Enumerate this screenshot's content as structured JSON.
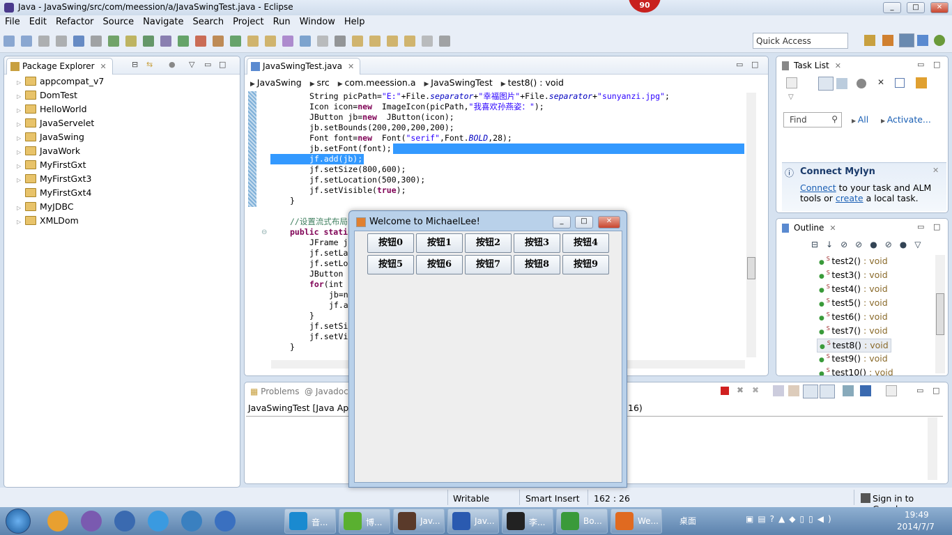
{
  "window": {
    "title": "Java - JavaSwing/src/com/meession/a/JavaSwingTest.java - Eclipse",
    "badge": "90",
    "min": "_",
    "max": "□",
    "close": "✕"
  },
  "menu": [
    "File",
    "Edit",
    "Refactor",
    "Source",
    "Navigate",
    "Search",
    "Project",
    "Run",
    "Window",
    "Help"
  ],
  "toolbar": {
    "icon_colors": [
      "#6b8fc4",
      "#6b8fc4",
      "#999",
      "#999",
      "#3c6ab3",
      "#888",
      "#4a8a3a",
      "#b0a030",
      "#3a7a3a",
      "#6a5a9a",
      "#3a8a3a",
      "#c04020",
      "#b06a20",
      "#3c8a3c",
      "#c8a040",
      "#c8a040",
      "#9a6ac0",
      "#5a8ac0",
      "#aaa",
      "#777",
      "#c8a040",
      "#c8a040",
      "#c8a040",
      "#c8a040",
      "#aaa",
      "#888"
    ],
    "quick_access": "Quick Access"
  },
  "package_explorer": {
    "title": "Package Explorer",
    "items": [
      {
        "label": "appcompat_v7",
        "expandable": true
      },
      {
        "label": "DomTest",
        "expandable": true
      },
      {
        "label": "HelloWorld",
        "expandable": true
      },
      {
        "label": "JavaServelet",
        "expandable": true
      },
      {
        "label": "JavaSwing",
        "expandable": true
      },
      {
        "label": "JavaWork",
        "expandable": true
      },
      {
        "label": "MyFirstGxt",
        "expandable": true
      },
      {
        "label": "MyFirstGxt3",
        "expandable": true
      },
      {
        "label": "MyFirstGxt4",
        "expandable": false
      },
      {
        "label": "MyJDBC",
        "expandable": true
      },
      {
        "label": "XMLDom",
        "expandable": true
      }
    ]
  },
  "editor": {
    "tab": "JavaSwingTest.java",
    "breadcrumb": [
      "JavaSwing",
      "src",
      "com.meession.a",
      "JavaSwingTest",
      "test8() : void"
    ],
    "lines": [
      {
        "indent": 4,
        "segs": [
          [
            "",
            "String picPath="
          ],
          [
            "str",
            "\"E:\""
          ],
          [
            "",
            "+File."
          ],
          [
            "it",
            "separator"
          ],
          [
            "",
            "+"
          ],
          [
            "str",
            "\"幸福图片\""
          ],
          [
            "",
            "+File."
          ],
          [
            "it",
            "separator"
          ],
          [
            "",
            "+"
          ],
          [
            "str",
            "\"sunyanzi.jpg\""
          ],
          [
            "",
            ";"
          ]
        ]
      },
      {
        "indent": 4,
        "segs": [
          [
            "",
            "Icon icon="
          ],
          [
            "kw",
            "new"
          ],
          [
            "",
            "  ImageIcon(picPath,"
          ],
          [
            "str",
            "\"我喜欢孙燕姿：\""
          ],
          [
            "",
            ");"
          ]
        ]
      },
      {
        "indent": 4,
        "segs": [
          [
            "",
            "JButton jb="
          ],
          [
            "kw",
            "new"
          ],
          [
            "",
            "  JButton(icon);"
          ]
        ]
      },
      {
        "indent": 4,
        "segs": [
          [
            "",
            "jb.setBounds(200,200,200,200);"
          ]
        ]
      },
      {
        "indent": 4,
        "segs": [
          [
            "",
            "Font font="
          ],
          [
            "kw",
            "new"
          ],
          [
            "",
            "  Font("
          ],
          [
            "str",
            "\"serif\""
          ],
          [
            "",
            ",Font."
          ],
          [
            "it",
            "BOLD"
          ],
          [
            "",
            ",28);"
          ]
        ]
      },
      {
        "indent": 4,
        "segs": [
          [
            "",
            "jb.setFont(font);"
          ]
        ],
        "sel": "after"
      },
      {
        "indent": 4,
        "segs": [
          [
            "",
            "jf.add(jb);"
          ]
        ],
        "sel": "full"
      },
      {
        "indent": 4,
        "segs": [
          [
            "",
            "jf.setSize(800,600);"
          ]
        ]
      },
      {
        "indent": 4,
        "segs": [
          [
            "",
            "jf.setLocation(500,300);"
          ]
        ]
      },
      {
        "indent": 4,
        "segs": [
          [
            "",
            "jf.setVisible("
          ],
          [
            "kw",
            "true"
          ],
          [
            "",
            ");"
          ]
        ]
      },
      {
        "indent": 2,
        "segs": [
          [
            "",
            "}"
          ]
        ]
      },
      {
        "indent": 0,
        "segs": []
      },
      {
        "indent": 2,
        "segs": [
          [
            "cm",
            "//设置流式布局管理"
          ]
        ]
      },
      {
        "indent": 2,
        "segs": [
          [
            "kw",
            "public static"
          ]
        ]
      },
      {
        "indent": 4,
        "segs": [
          [
            "",
            "JFrame j"
          ]
        ]
      },
      {
        "indent": 4,
        "segs": [
          [
            "",
            "jf.setLa"
          ]
        ]
      },
      {
        "indent": 4,
        "segs": [
          [
            "",
            "jf.setLo"
          ]
        ]
      },
      {
        "indent": 4,
        "segs": [
          [
            "",
            "JButton "
          ]
        ]
      },
      {
        "indent": 4,
        "segs": [
          [
            "kw",
            "for"
          ],
          [
            "",
            "(int "
          ]
        ]
      },
      {
        "indent": 6,
        "segs": [
          [
            "",
            "jb=n"
          ]
        ]
      },
      {
        "indent": 6,
        "segs": [
          [
            "",
            "jf.a"
          ]
        ]
      },
      {
        "indent": 4,
        "segs": [
          [
            "",
            "}"
          ]
        ]
      },
      {
        "indent": 4,
        "segs": [
          [
            "",
            "jf.setSi"
          ]
        ]
      },
      {
        "indent": 4,
        "segs": [
          [
            "",
            "jf.setVi"
          ]
        ]
      },
      {
        "indent": 2,
        "segs": [
          [
            "",
            "}"
          ]
        ]
      }
    ]
  },
  "task_list": {
    "title": "Task List",
    "find": "Find",
    "all": "All",
    "activate": "Activate...",
    "mylyn_title": "Connect Mylyn",
    "mylyn_connect": "Connect",
    "mylyn_text1": " to your task and ALM",
    "mylyn_text2": "tools or ",
    "mylyn_create": "create",
    "mylyn_text3": " a local task."
  },
  "outline": {
    "title": "Outline",
    "selected": "test8() : void",
    "items": [
      {
        "name": "test2()",
        "type": " : void"
      },
      {
        "name": "test3()",
        "type": " : void"
      },
      {
        "name": "test4()",
        "type": " : void"
      },
      {
        "name": "test5()",
        "type": " : void"
      },
      {
        "name": "test6()",
        "type": " : void"
      },
      {
        "name": "test7()",
        "type": " : void"
      },
      {
        "name": "test8()",
        "type": " : void"
      },
      {
        "name": "test9()",
        "type": " : void"
      },
      {
        "name": "test10()",
        "type": " : void"
      }
    ]
  },
  "console": {
    "tabs": [
      "Problems",
      "Javadoc"
    ],
    "header_left": "JavaSwingTest [Java App",
    "header_right": "16)"
  },
  "swing_window": {
    "title": "Welcome to MichaelLee!",
    "buttons": [
      "按钮0",
      "按钮1",
      "按钮2",
      "按钮3",
      "按钮4",
      "按钮5",
      "按钮6",
      "按钮7",
      "按钮8",
      "按钮9"
    ]
  },
  "status": {
    "writable": "Writable",
    "insert_mode": "Smart Insert",
    "position": "162 : 26",
    "sign_in": "Sign in to Google..."
  },
  "taskbar": {
    "pinned_colors": [
      "#e8a030",
      "#7a5ab0",
      "#3a6ab0",
      "#3a9ae0",
      "#3a80c0",
      "#3a70c0"
    ],
    "tasks": [
      {
        "label": "音...",
        "color": "#1a8ad0"
      },
      {
        "label": "博...",
        "color": "#5ab030"
      },
      {
        "label": "Jav...",
        "color": "#5a3a2a"
      },
      {
        "label": "Jav...",
        "color": "#2a5ab0"
      },
      {
        "label": "李...",
        "color": "#222"
      },
      {
        "label": "Bo...",
        "color": "#3a9a3a"
      },
      {
        "label": "We...",
        "color": "#e06a20"
      }
    ],
    "desktop": "桌面",
    "time": "19:49",
    "date": "2014/7/7"
  }
}
